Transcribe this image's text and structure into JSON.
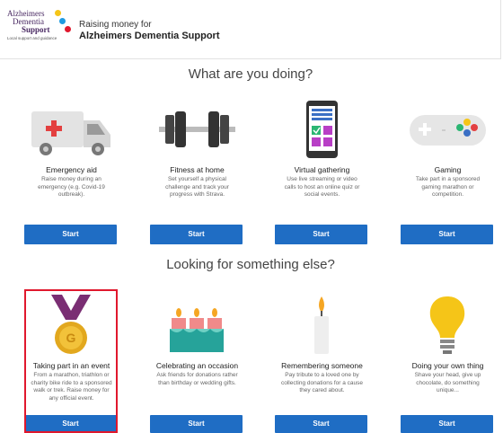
{
  "header": {
    "logo": {
      "line1": "Alzheimers",
      "line2": "Dementia",
      "line3": "Support",
      "tagline": "Local support and guidance"
    },
    "raising_label": "Raising money for",
    "charity_name": "Alzheimers Dementia Support"
  },
  "sections": {
    "primary_title": "What are you doing?",
    "secondary_title": "Looking for something else?"
  },
  "primary_cards": [
    {
      "title": "Emergency aid",
      "description": "Raise money during an emergency (e.g. Covid-19 outbreak).",
      "button": "Start",
      "icon": "ambulance-icon"
    },
    {
      "title": "Fitness at home",
      "description": "Set yourself a physical challenge and track your progress with Strava.",
      "button": "Start",
      "icon": "dumbbell-icon"
    },
    {
      "title": "Virtual gathering",
      "description": "Use live streaming or video calls to host an online quiz or social events.",
      "button": "Start",
      "icon": "phone-icon"
    },
    {
      "title": "Gaming",
      "description": "Take part in a sponsored gaming marathon or competition.",
      "button": "Start",
      "icon": "gamepad-icon"
    }
  ],
  "secondary_cards": [
    {
      "title": "Taking part in an event",
      "description": "From a marathon, triathlon or charity bike ride to a sponsored walk or trek. Raise money for any official event.",
      "button": "Start",
      "icon": "medal-icon",
      "selected": true
    },
    {
      "title": "Celebrating an occasion",
      "description": "Ask friends for donations rather than birthday or wedding gifts.",
      "button": "Start",
      "icon": "cake-icon"
    },
    {
      "title": "Remembering someone",
      "description": "Pay tribute to a loved one by collecting donations for a cause they cared about.",
      "button": "Start",
      "icon": "candle-icon"
    },
    {
      "title": "Doing your own thing",
      "description": "Shave your head, give up chocolate, do something unique...",
      "button": "Start",
      "icon": "lightbulb-icon"
    }
  ],
  "colors": {
    "accent": "#1f6dc4",
    "selected_border": "#e0182d",
    "brand": "#4a2a63"
  }
}
